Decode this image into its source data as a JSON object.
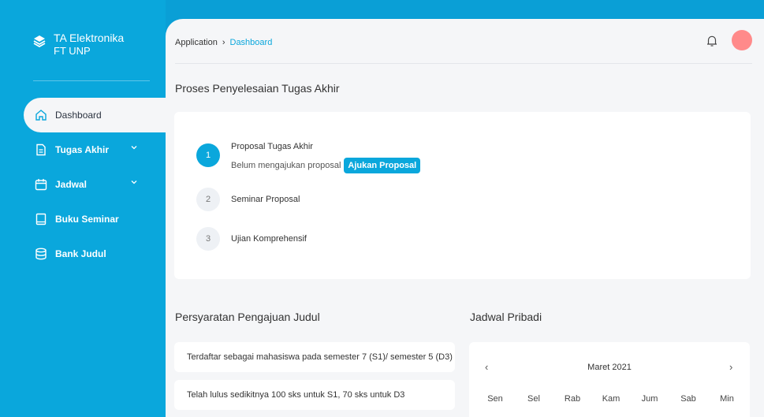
{
  "brand": {
    "name": "TA Elektronika",
    "sub": "FT UNP"
  },
  "nav": {
    "items": [
      {
        "label": "Dashboard"
      },
      {
        "label": "Tugas Akhir"
      },
      {
        "label": "Jadwal"
      },
      {
        "label": "Buku Seminar"
      },
      {
        "label": "Bank Judul"
      }
    ]
  },
  "breadcrumb": {
    "root": "Application",
    "separator": "›",
    "current": "Dashboard"
  },
  "process": {
    "title": "Proses Penyelesaian Tugas Akhir",
    "steps": [
      {
        "num": "1",
        "title": "Proposal Tugas Akhir",
        "status": "Belum mengajukan proposal",
        "action": "Ajukan Proposal"
      },
      {
        "num": "2",
        "title": "Seminar Proposal"
      },
      {
        "num": "3",
        "title": "Ujian Komprehensif"
      }
    ]
  },
  "requirements": {
    "title": "Persyaratan Pengajuan Judul",
    "items": [
      "Terdaftar sebagai mahasiswa pada semester 7 (S1)/ semester 5 (D3)",
      "Telah lulus sedikitnya 100 sks untuk S1, 70 sks untuk D3"
    ]
  },
  "schedule": {
    "title": "Jadwal Pribadi",
    "month": "Maret 2021",
    "prev": "‹",
    "next": "›",
    "days": [
      "Sen",
      "Sel",
      "Rab",
      "Kam",
      "Jum",
      "Sab",
      "Min"
    ]
  },
  "colors": {
    "accent": "#0aa7dc",
    "avatar": "#ff8a8a"
  }
}
